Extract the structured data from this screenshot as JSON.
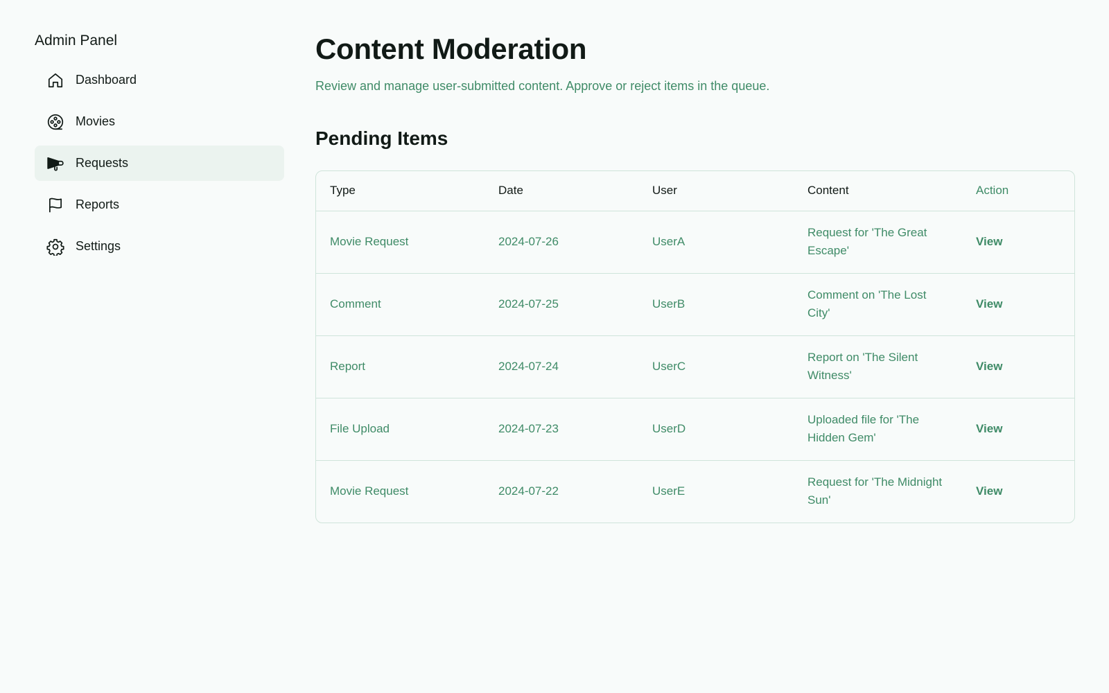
{
  "sidebar": {
    "title": "Admin Panel",
    "items": [
      {
        "label": "Dashboard",
        "icon": "home-icon",
        "active": false
      },
      {
        "label": "Movies",
        "icon": "film-reel-icon",
        "active": false
      },
      {
        "label": "Requests",
        "icon": "megaphone-icon",
        "active": true
      },
      {
        "label": "Reports",
        "icon": "flag-icon",
        "active": false
      },
      {
        "label": "Settings",
        "icon": "gear-icon",
        "active": false
      }
    ]
  },
  "main": {
    "title": "Content Moderation",
    "subtitle": "Review and manage user-submitted content. Approve or reject items in the queue.",
    "section_title": "Pending Items",
    "table": {
      "headers": [
        "Type",
        "Date",
        "User",
        "Content",
        "Action"
      ],
      "rows": [
        {
          "type": "Movie Request",
          "date": "2024-07-26",
          "user": "UserA",
          "content": "Request for 'The Great Escape'",
          "action": "View"
        },
        {
          "type": "Comment",
          "date": "2024-07-25",
          "user": "UserB",
          "content": "Comment on 'The Lost City'",
          "action": "View"
        },
        {
          "type": "Report",
          "date": "2024-07-24",
          "user": "UserC",
          "content": "Report on 'The Silent Witness'",
          "action": "View"
        },
        {
          "type": "File Upload",
          "date": "2024-07-23",
          "user": "UserD",
          "content": "Uploaded file for 'The Hidden Gem'",
          "action": "View"
        },
        {
          "type": "Movie Request",
          "date": "2024-07-22",
          "user": "UserE",
          "content": "Request for 'The Midnight Sun'",
          "action": "View"
        }
      ]
    }
  },
  "colors": {
    "background": "#f8fbfa",
    "accent": "#3f8b67",
    "active_nav": "#ebf3ef",
    "border": "#cfe4da",
    "text": "#111a16"
  }
}
